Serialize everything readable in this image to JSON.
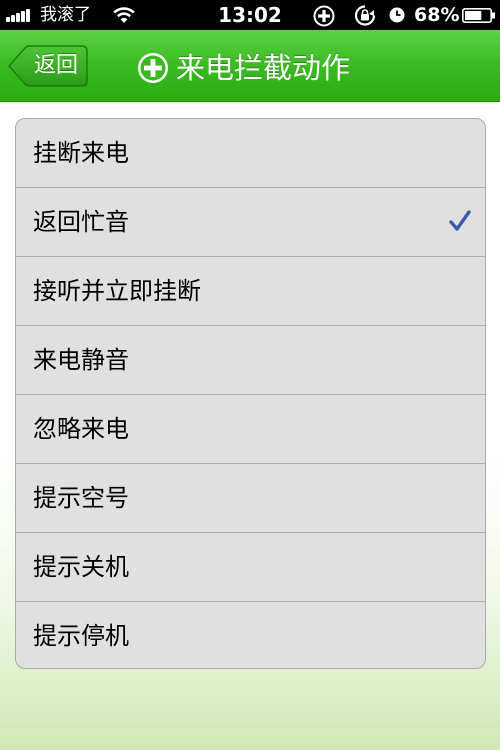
{
  "status_bar": {
    "carrier": "我滚了",
    "time": "13:02",
    "battery_percent": "68%",
    "battery_level": 0.68,
    "icons": [
      "signal-bars-icon",
      "wifi-icon",
      "plus-circle-icon",
      "rotation-lock-icon",
      "clock-icon",
      "battery-icon"
    ]
  },
  "navbar": {
    "back_label": "返回",
    "title": "来电拦截动作",
    "title_icon": "plus-circle-icon",
    "bar_color": "#3dbd24"
  },
  "list": {
    "items": [
      {
        "label": "挂断来电",
        "selected": false
      },
      {
        "label": "返回忙音",
        "selected": true
      },
      {
        "label": "接听并立即挂断",
        "selected": false
      },
      {
        "label": "来电静音",
        "selected": false
      },
      {
        "label": "忽略来电",
        "selected": false
      },
      {
        "label": "提示空号",
        "selected": false
      },
      {
        "label": "提示关机",
        "selected": false
      },
      {
        "label": "提示停机",
        "selected": false
      }
    ],
    "check_color": "#3b5ba5"
  }
}
